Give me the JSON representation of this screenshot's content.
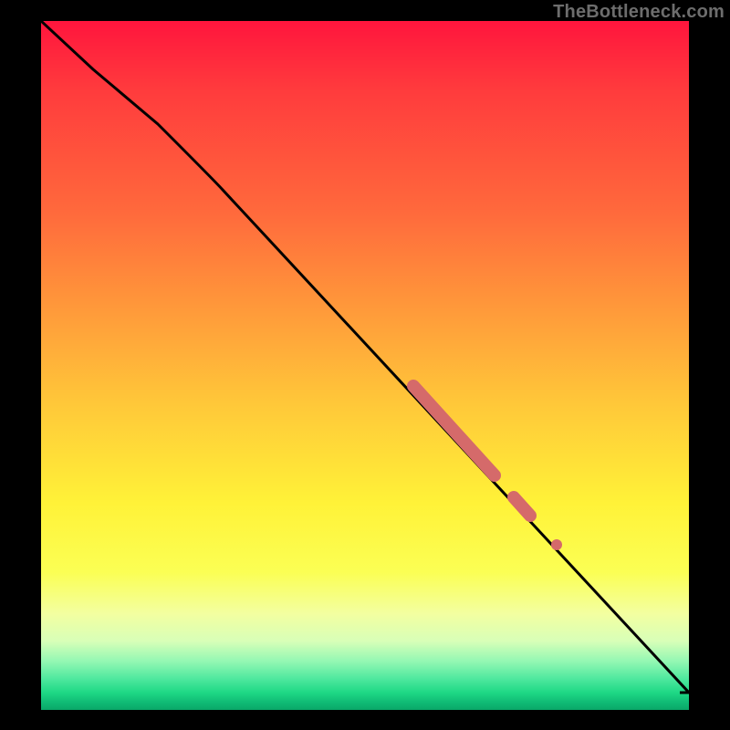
{
  "attribution": "TheBottleneck.com",
  "chart_data": {
    "type": "line",
    "title": "",
    "xlabel": "",
    "ylabel": "",
    "xlim": [
      0,
      100
    ],
    "ylim": [
      0,
      100
    ],
    "series": [
      {
        "name": "curve",
        "x": [
          0,
          8,
          18,
          28,
          100,
          100
        ],
        "y": [
          100,
          93,
          85,
          78,
          2.5,
          2.5
        ]
      }
    ],
    "highlight_segments": [
      {
        "x0": 57.5,
        "y0": 47.0,
        "x1": 70.0,
        "y1": 34.0,
        "thick": true
      },
      {
        "x0": 73.0,
        "y0": 30.8,
        "x1": 75.5,
        "y1": 28.2,
        "thick": true
      },
      {
        "x0": 79.5,
        "y0": 24.0,
        "x1": 80.0,
        "y1": 23.5,
        "thick": false
      }
    ],
    "colors": {
      "curve": "#000000",
      "highlight": "#d56a6a"
    }
  }
}
